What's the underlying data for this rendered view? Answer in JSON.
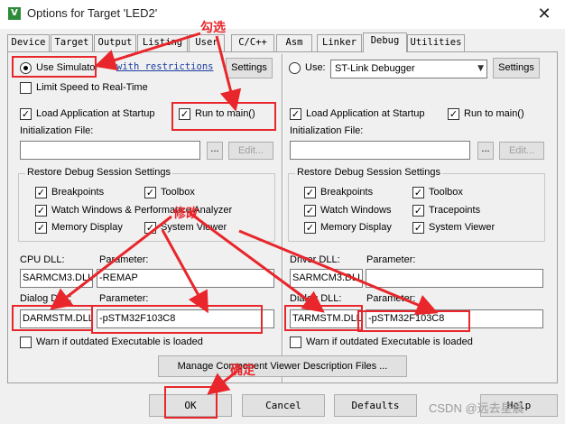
{
  "window": {
    "title": "Options for Target 'LED2'",
    "icon": "V",
    "close": "✕"
  },
  "tabs": [
    "Device",
    "Target",
    "Output",
    "Listing",
    "User",
    "C/C++",
    "Asm",
    "Linker",
    "Debug",
    "Utilities"
  ],
  "active_tab": "Debug",
  "left": {
    "use_simulator": "Use Simulator",
    "with_restrictions": "with restrictions",
    "settings": "Settings",
    "limit_speed": "Limit Speed to Real-Time",
    "load_app": "Load Application at Startup",
    "run_to_main": "Run to main()",
    "init_file_label": "Initialization File:",
    "browse": "...",
    "edit": "Edit...",
    "restore_title": "Restore Debug Session Settings",
    "breakpoints": "Breakpoints",
    "toolbox": "Toolbox",
    "watch_windows": "Watch Windows & Performance Analyzer",
    "memory_display": "Memory Display",
    "system_viewer": "System Viewer",
    "cpu_dll_label": "CPU DLL:",
    "cpu_param_label": "Parameter:",
    "cpu_dll": "SARMCM3.DLL",
    "cpu_param": "-REMAP",
    "dialog_dll_label": "Dialog DLL:",
    "dialog_param_label": "Parameter:",
    "dialog_dll": "DARMSTM.DLL",
    "dialog_param": "-pSTM32F103C8",
    "warn_outdated": "Warn if outdated Executable is loaded"
  },
  "right": {
    "use": "Use:",
    "debugger": "ST-Link Debugger",
    "settings": "Settings",
    "load_app": "Load Application at Startup",
    "run_to_main": "Run to main()",
    "init_file_label": "Initialization File:",
    "browse": "...",
    "edit": "Edit...",
    "restore_title": "Restore Debug Session Settings",
    "breakpoints": "Breakpoints",
    "toolbox": "Toolbox",
    "watch_windows": "Watch Windows",
    "tracepoints": "Tracepoints",
    "memory_display": "Memory Display",
    "system_viewer": "System Viewer",
    "driver_dll_label": "Driver DLL:",
    "driver_param_label": "Parameter:",
    "driver_dll": "SARMCM3.DLL",
    "driver_param": "",
    "dialog_dll_label": "Dialog DLL:",
    "dialog_param_label": "Parameter:",
    "dialog_dll": "TARMSTM.DLL",
    "dialog_param": "-pSTM32F103C8",
    "warn_outdated": "Warn if outdated Executable is loaded"
  },
  "manage_button": "Manage Component Viewer Description Files ...",
  "bottom": {
    "ok": "OK",
    "cancel": "Cancel",
    "defaults": "Defaults",
    "help": "Help"
  },
  "annotations": {
    "check": "勾选",
    "modify": "修改",
    "confirm": "确定"
  },
  "watermark": "CSDN @远去星晨",
  "colors": {
    "annotation": "#e8262b",
    "link": "#1f3fa0"
  }
}
